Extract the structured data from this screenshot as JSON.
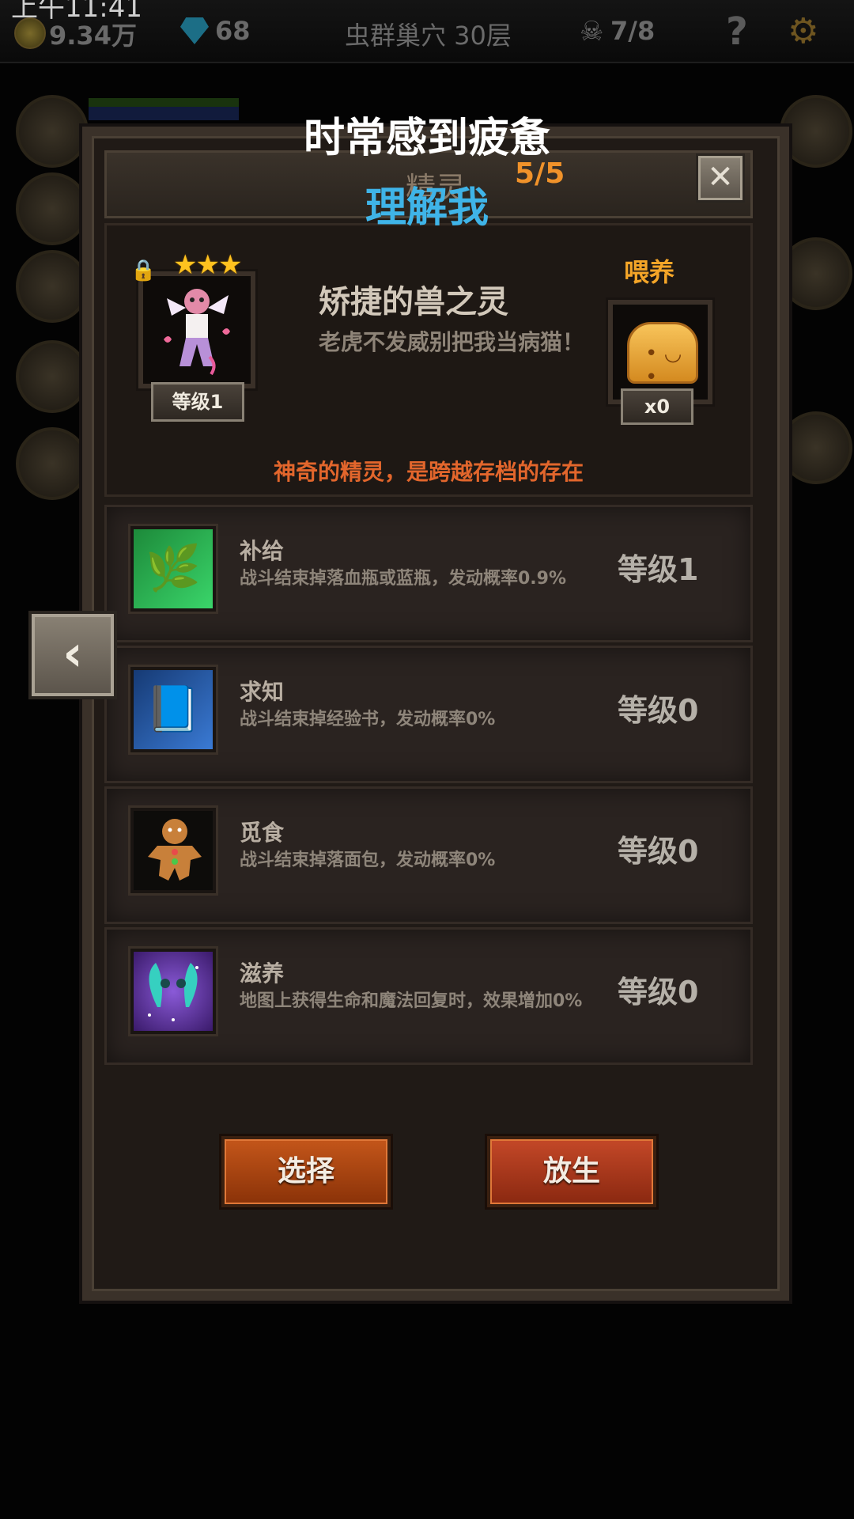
{
  "hud": {
    "clock": "上午11:41",
    "gold": "9.34万",
    "gems": "68",
    "location": "虫群巢穴 30层",
    "kills": "7/8",
    "help": "?",
    "settings_icon": "gear-icon"
  },
  "overlay": {
    "line1": "时常感到疲惫",
    "line2": "理解我"
  },
  "panel": {
    "title": "精灵",
    "count": "5/5",
    "close": "✕"
  },
  "pet": {
    "stars": "★★★",
    "level": "等级1",
    "name": "矫捷的兽之灵",
    "description": "老虎不发威别把我当病猫！",
    "feed_label": "喂养",
    "food_count": "x0",
    "tagline": "神奇的精灵，是跨越存档的存在",
    "locked": true
  },
  "skills": [
    {
      "name": "补给",
      "desc": "战斗结束掉落血瓶或蓝瓶，发动概率0.9%",
      "level": "等级1",
      "icon": "leaf-hand-icon"
    },
    {
      "name": "求知",
      "desc": "战斗结束掉经验书，发动概率0%",
      "level": "等级0",
      "icon": "book-icon"
    },
    {
      "name": "觅食",
      "desc": "战斗结束掉落面包，发动概率0%",
      "level": "等级0",
      "icon": "gingerbread-icon"
    },
    {
      "name": "滋养",
      "desc": "地图上获得生命和魔法回复时，效果增加0%",
      "level": "等级0",
      "icon": "fairy-icon"
    }
  ],
  "buttons": {
    "select": "选择",
    "release": "放生"
  },
  "nav": {
    "prev": "‹"
  },
  "colors": {
    "accent_orange": "#f0922a",
    "tagline": "#e2662c",
    "overlay_blue": "#3fb4e8",
    "button_select": "#c4561a",
    "button_release": "#c44828"
  }
}
